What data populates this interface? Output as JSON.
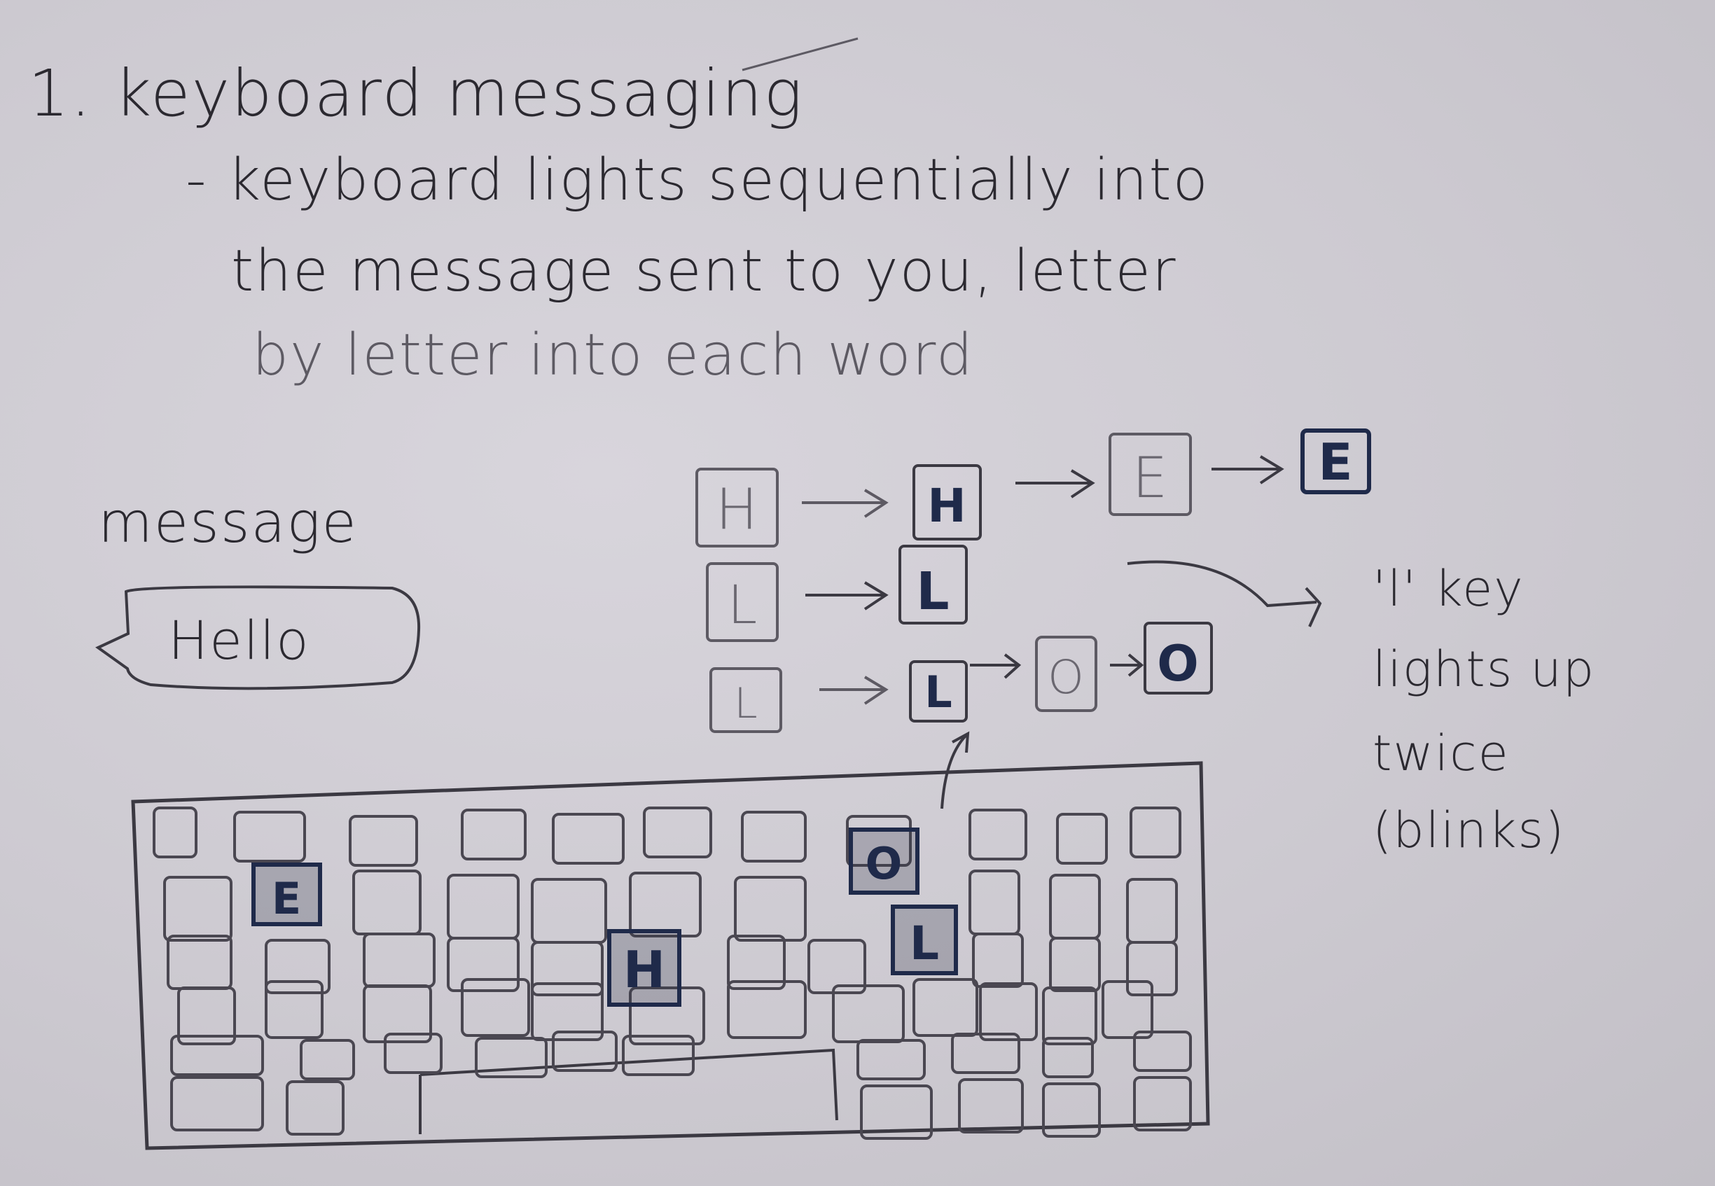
{
  "notes": {
    "title": "1. keyboard messaging",
    "description_line1": "- keyboard lights sequentially into",
    "description_line2": "the message sent to you, letter",
    "description_line3": "by letter into each word",
    "message_label": "message",
    "message_text": "Hello",
    "annotation_line1": "'l' key",
    "annotation_line2": "lights up",
    "annotation_line3": "twice",
    "annotation_line4": "(blinks)"
  },
  "sequence": {
    "rows": [
      [
        "H",
        "H",
        "E",
        "E"
      ],
      [
        "L",
        "L"
      ],
      [
        "L",
        "L",
        "O",
        "O"
      ]
    ]
  },
  "keyboard": {
    "lit_keys": [
      "E",
      "O",
      "H",
      "L"
    ]
  },
  "colors": {
    "paper": "#cfccd3",
    "pencil": "#3b3942",
    "ink": "#1f2a4a"
  }
}
